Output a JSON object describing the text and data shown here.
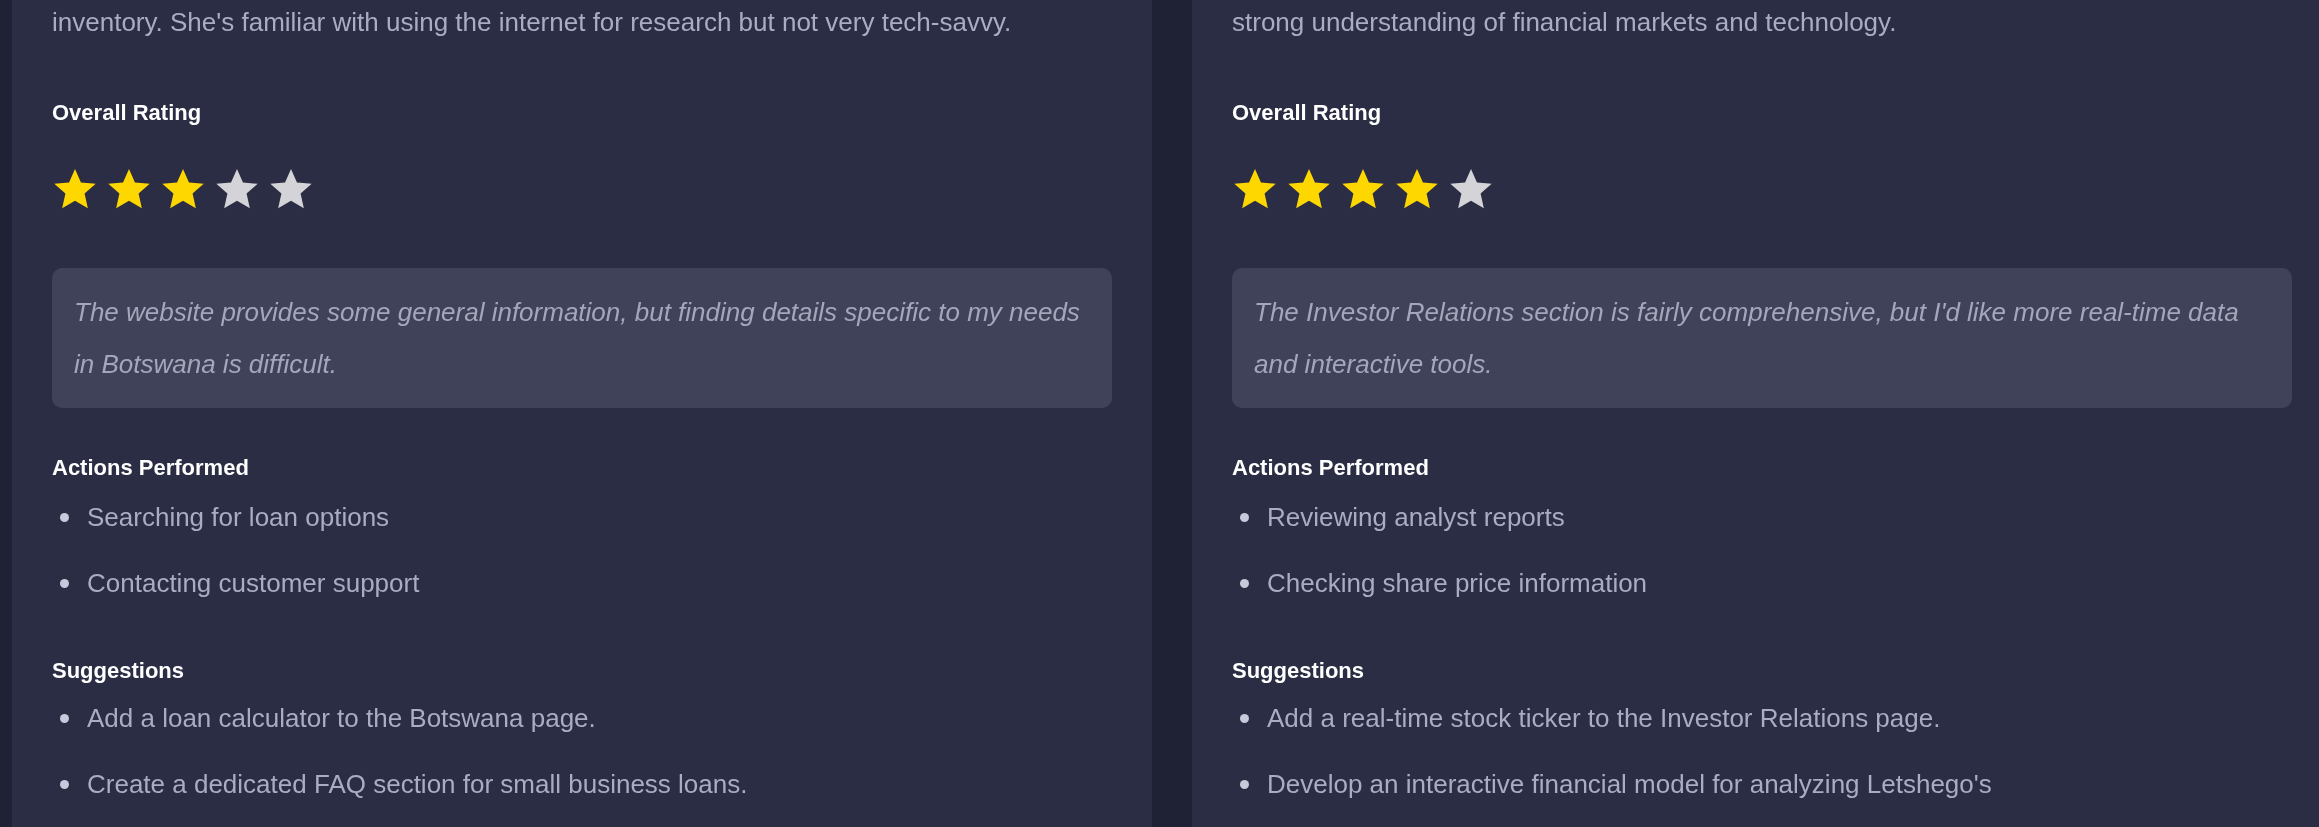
{
  "personas": [
    {
      "description": "inventory. She's familiar with using the internet for research but not very tech-savvy.",
      "rating_label": "Overall Rating",
      "stars": 3,
      "quote": "The website provides some general information, but finding details specific to my needs in Botswana is difficult.",
      "actions_heading": "Actions Performed",
      "actions": [
        "Searching for loan options",
        "Contacting customer support"
      ],
      "suggestions_heading": "Suggestions",
      "suggestions": [
        "Add a loan calculator to the Botswana page.",
        "Create a dedicated FAQ section for small business loans."
      ]
    },
    {
      "description": "strong understanding of financial markets and technology.",
      "rating_label": "Overall Rating",
      "stars": 4,
      "quote": "The Investor Relations section is fairly comprehensive, but I'd like more real-time data and interactive tools.",
      "actions_heading": "Actions Performed",
      "actions": [
        "Reviewing analyst reports",
        "Checking share price information"
      ],
      "suggestions_heading": "Suggestions",
      "suggestions": [
        "Add a real-time stock ticker to the Investor Relations page.",
        "Develop an interactive financial model for analyzing Letshego's"
      ]
    }
  ]
}
